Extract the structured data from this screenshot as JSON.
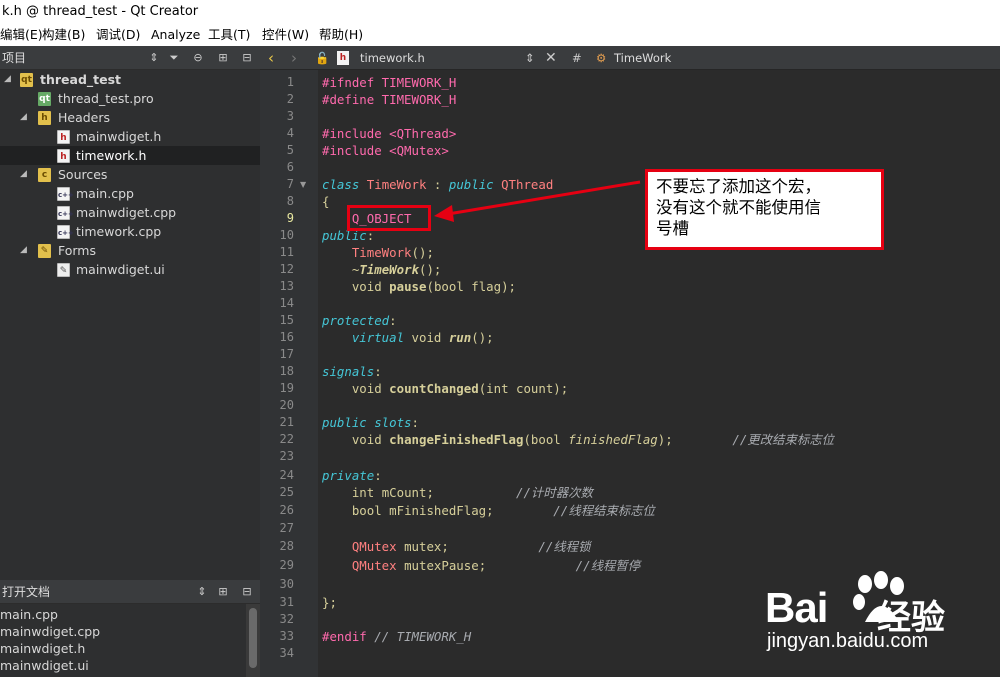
{
  "window": {
    "title": "k.h @ thread_test - Qt Creator"
  },
  "menu": [
    "编辑(E)",
    "构建(B)",
    "调试(D)",
    "Analyze",
    "工具(T)",
    "控件(W)",
    "帮助(H)"
  ],
  "projects": {
    "title": "项目",
    "tree": [
      {
        "label": "thread_test",
        "bold": true
      },
      {
        "label": "thread_test.pro"
      },
      {
        "label": "Headers"
      },
      {
        "label": "mainwdiget.h"
      },
      {
        "label": "timework.h",
        "selected": true
      },
      {
        "label": "Sources"
      },
      {
        "label": "main.cpp"
      },
      {
        "label": "mainwdiget.cpp"
      },
      {
        "label": "timework.cpp"
      },
      {
        "label": "Forms"
      },
      {
        "label": "mainwdiget.ui"
      }
    ]
  },
  "open_docs": {
    "title": "打开文档",
    "items": [
      "main.cpp",
      "mainwdiget.cpp",
      "mainwdiget.h",
      "mainwdiget.ui"
    ]
  },
  "editor": {
    "file": "timework.h",
    "symbol": "TimeWork",
    "current_line": 9,
    "lines": [
      "1",
      "2",
      "3",
      "4",
      "5",
      "6",
      "7",
      "8",
      "9",
      "10",
      "11",
      "12",
      "13",
      "14",
      "15",
      "16",
      "17",
      "18",
      "19",
      "20",
      "21",
      "22",
      "23",
      "24",
      "25",
      "26",
      "27",
      "28",
      "29",
      "30",
      "31",
      "32",
      "33",
      "34"
    ]
  },
  "annotation": {
    "text": "不要忘了添加这个宏，\n没有这个就不能使用信\n号槽",
    "color": "#e60012"
  },
  "watermark": {
    "brand": "Bai",
    "brand2": "经验",
    "url": "jingyan.baidu.com"
  }
}
